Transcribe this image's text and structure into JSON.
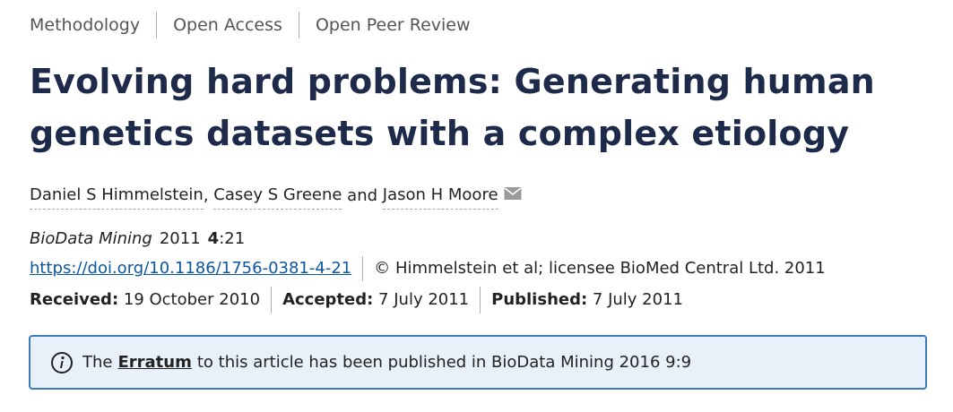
{
  "tags": [
    "Methodology",
    "Open Access",
    "Open Peer Review"
  ],
  "title": "Evolving hard problems: Generating human genetics datasets with a complex etiology",
  "authors": {
    "list": [
      "Daniel S Himmelstein",
      "Casey S Greene",
      "Jason H Moore"
    ],
    "sep1": ", ",
    "sep2": " and "
  },
  "citation": {
    "journal": "BioData Mining",
    "year": "2011",
    "volume": "4",
    "article": ":21"
  },
  "doi": {
    "url": "https://doi.org/10.1186/1756-0381-4-21",
    "copyright": "© Himmelstein et al; licensee BioMed Central Ltd. 2011"
  },
  "dates": [
    {
      "label": "Received:",
      "value": " 19 October 2010"
    },
    {
      "label": "Accepted:",
      "value": " 7 July 2011"
    },
    {
      "label": "Published:",
      "value": " 7 July 2011"
    }
  ],
  "notice": {
    "prefix": "The",
    "link": "Erratum",
    "suffix": "to this article has been published in BioData Mining 2016 9:9"
  },
  "icons": {
    "mail": "envelope-icon",
    "info": "info-icon"
  }
}
